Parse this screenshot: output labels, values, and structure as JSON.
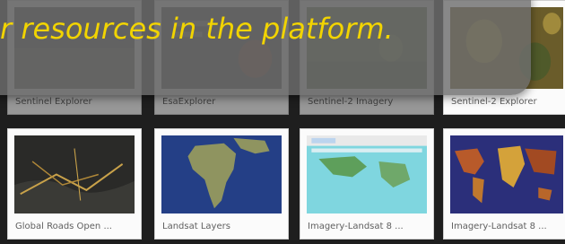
{
  "banner": {
    "text": "r resources in the platform."
  },
  "gallery": {
    "row1": [
      {
        "title": "Sentinel Explorer",
        "thumb_icon": "sentinel-explorer-thumbnail"
      },
      {
        "title": "EsaExplorer",
        "thumb_icon": "esa-explorer-thumbnail"
      },
      {
        "title": "Sentinel-2 Imagery",
        "thumb_icon": "sentinel2-imagery-thumbnail"
      },
      {
        "title": "Sentinel-2 Explorer",
        "thumb_icon": "sentinel2-explorer-thumbnail"
      }
    ],
    "row2": [
      {
        "title": "Global Roads Open ...",
        "thumb_icon": "global-roads-thumbnail"
      },
      {
        "title": "Landsat Layers",
        "thumb_icon": "landsat-layers-thumbnail"
      },
      {
        "title": "Imagery-Landsat 8 ...",
        "thumb_icon": "imagery-landsat-browser-thumbnail"
      },
      {
        "title": "Imagery-Landsat 8 ...",
        "thumb_icon": "imagery-landsat-worldmap-thumbnail"
      }
    ]
  },
  "colors": {
    "banner_text": "#f2d400",
    "banner_bg": "#6e6e6e",
    "page_bg": "#1e1e1e"
  }
}
